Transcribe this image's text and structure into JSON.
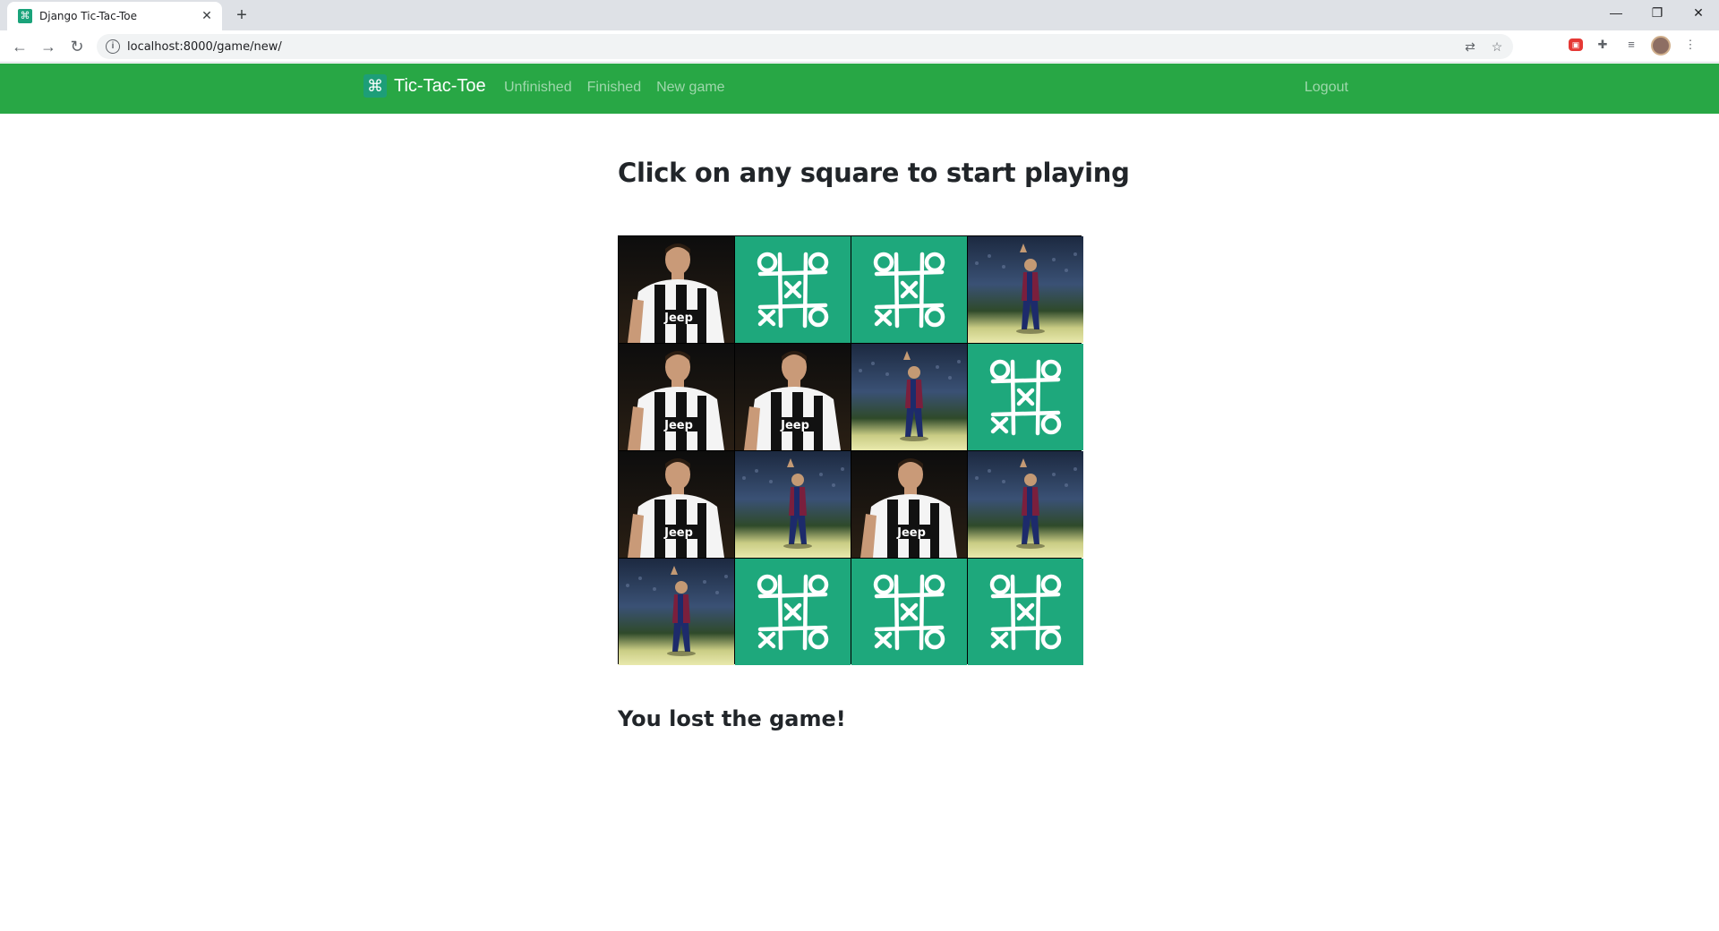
{
  "browser": {
    "tab_title": "Django Tic-Tac-Toe",
    "new_tab_glyph": "+",
    "url": "localhost:8000/game/new/"
  },
  "navbar": {
    "brand": "Tic-Tac-Toe",
    "links": [
      "Unfinished",
      "Finished",
      "New game"
    ],
    "logout": "Logout",
    "color": "#28a745"
  },
  "game": {
    "heading": "Click on any square to start playing",
    "result": "You lost the game!",
    "board": [
      [
        "ronaldo",
        "empty",
        "empty",
        "messi"
      ],
      [
        "ronaldo",
        "ronaldo",
        "messi",
        "empty"
      ],
      [
        "ronaldo",
        "messi",
        "ronaldo",
        "messi"
      ],
      [
        "messi",
        "empty",
        "empty",
        "empty"
      ]
    ],
    "ronaldo_shirt_text": "Jeep",
    "empty_color": "#1ea87c"
  }
}
